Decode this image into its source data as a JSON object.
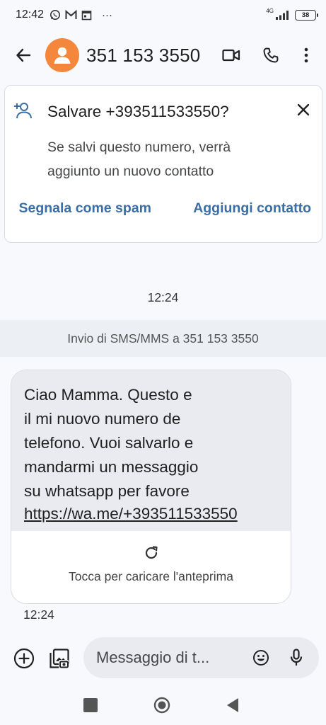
{
  "status_bar": {
    "time": "12:42",
    "network": "4G",
    "battery": "38",
    "overflow": "···"
  },
  "app_bar": {
    "title": "351 153 3550"
  },
  "save_banner": {
    "title": "Salvare +393511533550?",
    "body": "Se salvi questo numero, verrà aggiunto un nuovo contatto",
    "spam_action": "Segnala come spam",
    "add_action": "Aggiungi contatto"
  },
  "conversation": {
    "timestamp": "12:24",
    "info_strip": "Invio di SMS/MMS a 351 153 3550",
    "message": {
      "text": "Ciao Mamma. Questo e\nil mi nuovo numero de\ntelefono. Vuoi salvarlo e\nmandarmi un messaggio\nsu whatsapp per favore",
      "link": "https://wa.me/+393511533550",
      "preview_label": "Tocca per caricare l'anteprima",
      "time": "12:24"
    }
  },
  "compose": {
    "placeholder": "Messaggio di t..."
  },
  "colors": {
    "avatar": "#f4873b",
    "action_link": "#3a6ea5",
    "bubble": "#e9ebf0"
  }
}
